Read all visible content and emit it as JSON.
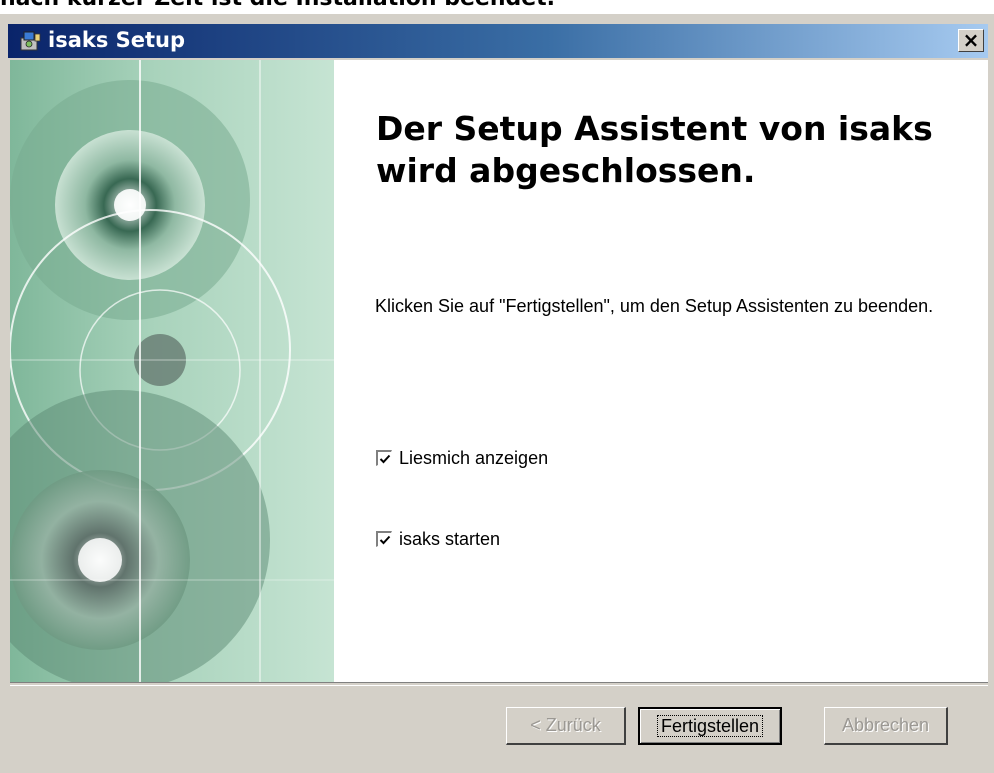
{
  "page_caption": "nach kurzer Zeit ist die Installation beendet.",
  "window": {
    "title": "isaks Setup",
    "close_label": "×"
  },
  "wizard": {
    "heading": "Der Setup Assistent von isaks wird abgeschlossen.",
    "info": "Klicken Sie auf \"Fertigstellen\", um den Setup Assistenten zu beenden.",
    "checkboxes": [
      {
        "label": "Liesmich anzeigen",
        "checked": true
      },
      {
        "label": "isaks starten",
        "checked": true
      }
    ]
  },
  "buttons": {
    "back": "< Zurück",
    "finish": "Fertigstellen",
    "cancel": "Abbrechen"
  },
  "colors": {
    "titlebar_start": "#0a246a",
    "titlebar_end": "#a6caf0",
    "panel_green": "#a9d3bc",
    "dialog_face": "#d4d0c8"
  }
}
